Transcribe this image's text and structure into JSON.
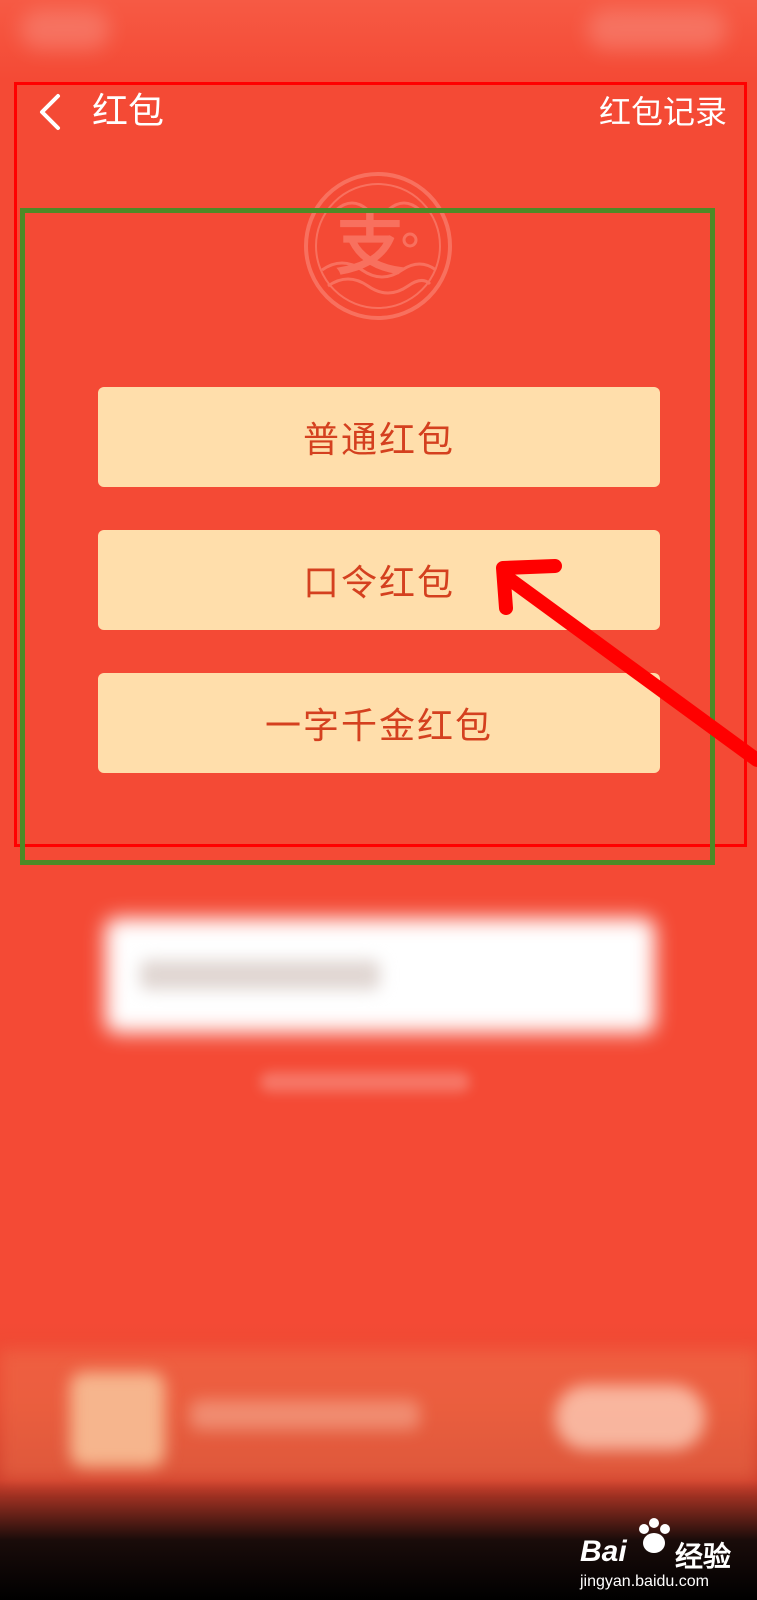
{
  "nav": {
    "title": "红包",
    "record_label": "红包记录"
  },
  "buttons": {
    "normal": "普通红包",
    "command": "口令红包",
    "golden_word": "一字千金红包"
  },
  "logo": {
    "glyph": "支"
  },
  "watermark": {
    "brand_left": "Bai",
    "brand_right": "经验",
    "url": "jingyan.baidu.com"
  },
  "colors": {
    "background": "#f44a35",
    "button": "#ffdeab",
    "button_text": "#d4401f",
    "annotation_red": "#ff0000",
    "annotation_green": "#4e8a26"
  }
}
